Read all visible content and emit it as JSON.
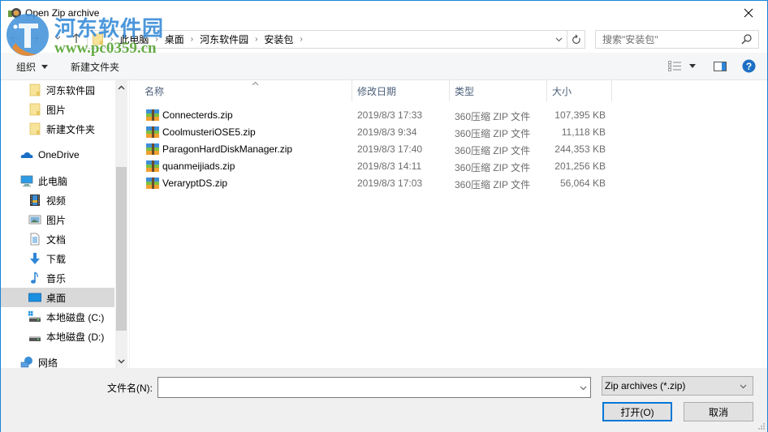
{
  "window": {
    "title": "Open Zip archive",
    "close_label": "✕"
  },
  "navigation": {
    "back_icon": "‹",
    "forward_icon": "›",
    "recent_icon": "⌄",
    "up_icon": "↑",
    "breadcrumbs": [
      "此电脑",
      "桌面",
      "河东软件园",
      "安装包"
    ],
    "separator": "›",
    "search_placeholder": "搜索\"安装包\""
  },
  "toolbar": {
    "organize_label": "组织",
    "new_folder_label": "新建文件夹"
  },
  "sidebar": {
    "items": [
      {
        "label": "河东软件园",
        "icon": "folder-icon",
        "selected": false
      },
      {
        "label": "图片",
        "icon": "folder-icon",
        "selected": false
      },
      {
        "label": "新建文件夹",
        "icon": "folder-icon",
        "selected": false
      },
      {
        "label": "OneDrive",
        "icon": "onedrive-icon",
        "selected": false
      },
      {
        "label": "此电脑",
        "icon": "computer-icon",
        "selected": false
      },
      {
        "label": "视频",
        "icon": "video-icon",
        "selected": false
      },
      {
        "label": "图片",
        "icon": "pictures-icon",
        "selected": false
      },
      {
        "label": "文档",
        "icon": "documents-icon",
        "selected": false
      },
      {
        "label": "下载",
        "icon": "download-icon",
        "selected": false
      },
      {
        "label": "音乐",
        "icon": "music-icon",
        "selected": false
      },
      {
        "label": "桌面",
        "icon": "desktop-icon",
        "selected": true
      },
      {
        "label": "本地磁盘 (C:)",
        "icon": "drive-c-icon",
        "selected": false
      },
      {
        "label": "本地磁盘 (D:)",
        "icon": "drive-icon",
        "selected": false
      },
      {
        "label": "网络",
        "icon": "network-icon",
        "selected": false
      }
    ]
  },
  "filelist": {
    "columns": {
      "name": "名称",
      "date": "修改日期",
      "type": "类型",
      "size": "大小"
    },
    "files": [
      {
        "name": "Connecterds.zip",
        "date": "2019/8/3 17:33",
        "type": "360压缩 ZIP 文件",
        "size": "107,395 KB"
      },
      {
        "name": "CoolmusteriOSE5.zip",
        "date": "2019/8/3 9:34",
        "type": "360压缩 ZIP 文件",
        "size": "11,118 KB"
      },
      {
        "name": "ParagonHardDiskManager.zip",
        "date": "2019/8/3 17:40",
        "type": "360压缩 ZIP 文件",
        "size": "244,353 KB"
      },
      {
        "name": "quanmeijiads.zip",
        "date": "2019/8/3 14:11",
        "type": "360压缩 ZIP 文件",
        "size": "201,256 KB"
      },
      {
        "name": "VeraryptDS.zip",
        "date": "2019/8/3 17:03",
        "type": "360压缩 ZIP 文件",
        "size": "56,064 KB"
      }
    ]
  },
  "bottom": {
    "filename_label": "文件名(N):",
    "filename_value": "",
    "filter_value": "Zip archives (*.zip)",
    "open_label": "打开(O)",
    "cancel_label": "取消"
  },
  "watermark": {
    "site_name": "河东软件园",
    "url": "www.pc0359.cn"
  },
  "colors": {
    "accent": "#0078d7",
    "window_border": "#1883d7",
    "header_text": "#4c607a",
    "selected_bg": "#d9d9d9"
  }
}
